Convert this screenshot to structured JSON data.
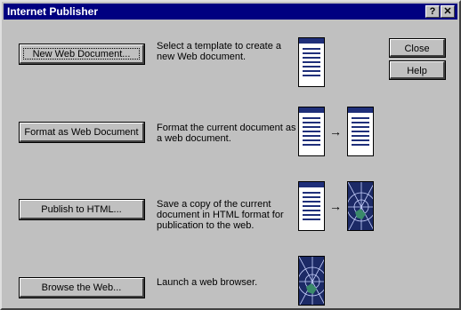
{
  "window": {
    "title": "Internet Publisher",
    "help_glyph": "?",
    "close_glyph": "✕"
  },
  "buttons": {
    "new_doc": "New Web Document...",
    "format": "Format as Web Document",
    "publish": "Publish to HTML...",
    "browse": "Browse the Web...",
    "close": "Close",
    "help": "Help"
  },
  "descriptions": {
    "new_doc": "Select a template to create a new Web document.",
    "format": "Format the current document as a web document.",
    "publish": "Save a copy of the current document in HTML format for publication to the web.",
    "browse": "Launch a web browser."
  },
  "icons": {
    "new_doc": "document-icon",
    "format": "document-to-web-document-icon",
    "publish": "document-to-web-page-icon",
    "browse": "web-browser-icon"
  },
  "colors": {
    "titlebar": "#000080",
    "face": "#c0c0c0",
    "icon_navy": "#1f2f7a",
    "web_green": "#3a8a6a"
  },
  "arrow_glyph": "→"
}
